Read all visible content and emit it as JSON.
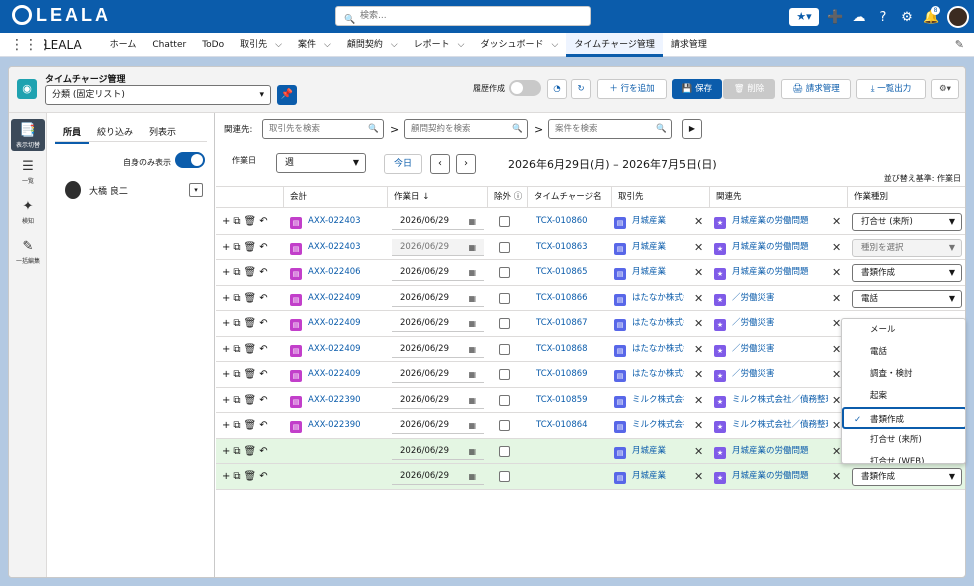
{
  "header": {
    "logo": "LEALA",
    "search_placeholder": "検索...",
    "notification_count": "8"
  },
  "nav": {
    "app_name": "LEALA",
    "items": [
      {
        "label": "ホーム",
        "caret": false
      },
      {
        "label": "Chatter",
        "caret": false
      },
      {
        "label": "ToDo",
        "caret": false
      },
      {
        "label": "取引先",
        "caret": true
      },
      {
        "label": "案件",
        "caret": true
      },
      {
        "label": "顧問契約",
        "caret": true
      },
      {
        "label": "レポート",
        "caret": true
      },
      {
        "label": "ダッシュボード",
        "caret": true
      },
      {
        "label": "タイムチャージ管理",
        "caret": false,
        "active": true
      },
      {
        "label": "請求管理",
        "caret": false
      }
    ]
  },
  "page": {
    "title": "タイムチャージ管理",
    "list_select": "分類 (固定リスト)",
    "history_label": "履歴作成",
    "add_row": "行を追加",
    "save": "保存",
    "delete": "削除",
    "billing": "請求管理",
    "export": "一覧出力"
  },
  "rail": {
    "items": [
      "表示切替",
      "一覧",
      "検知",
      "一括編集"
    ]
  },
  "left_panel": {
    "tabs": [
      "所員",
      "絞り込み",
      "列表示"
    ],
    "self_only_label": "自身のみ表示",
    "employee": "大橋 良二"
  },
  "filters": {
    "related_label": "関連先:",
    "account_placeholder": "取引先を検索",
    "contract_placeholder": "顧問契約を検索",
    "matter_placeholder": "案件を検索",
    "work_date_label": "作業日",
    "period": "週",
    "today": "今日",
    "range": "2026年6月29日(月) – 2026年7月5日(日)",
    "sort_label": "並び替え基準: 作業日"
  },
  "table": {
    "columns": [
      "会計",
      "作業日 ↓",
      "除外",
      "タイムチャージ名",
      "取引先",
      "関連先",
      "作業種別"
    ],
    "rows": [
      {
        "account": "AXX-022403",
        "date": "2026/06/29",
        "name": "TCX-010860",
        "client": "月城産業",
        "related": "月城産業の労働問題",
        "type": "打合せ (来所)",
        "green": false,
        "disabled": false
      },
      {
        "account": "AXX-022403",
        "date": "2026/06/29",
        "name": "TCX-010863",
        "client": "月城産業",
        "related": "月城産業の労働問題",
        "type": "種別を選択",
        "green": false,
        "disabled": true
      },
      {
        "account": "AXX-022406",
        "date": "2026/06/29",
        "name": "TCX-010865",
        "client": "月城産業",
        "related": "月城産業の労働問題",
        "type": "書類作成",
        "green": false,
        "disabled": false
      },
      {
        "account": "AXX-022409",
        "date": "2026/06/29",
        "name": "TCX-010866",
        "client": "はたなか株式会社",
        "related": "／労働災害",
        "type": "電話",
        "green": false,
        "disabled": false
      },
      {
        "account": "AXX-022409",
        "date": "2026/06/29",
        "name": "TCX-010867",
        "client": "はたなか株式会社",
        "related": "／労働災害",
        "type": "",
        "green": false,
        "disabled": false
      },
      {
        "account": "AXX-022409",
        "date": "2026/06/29",
        "name": "TCX-010868",
        "client": "はたなか株式会社",
        "related": "／労働災害",
        "type": "",
        "green": false,
        "disabled": false
      },
      {
        "account": "AXX-022409",
        "date": "2026/06/29",
        "name": "TCX-010869",
        "client": "はたなか株式会社",
        "related": "／労働災害",
        "type": "",
        "green": false,
        "disabled": false
      },
      {
        "account": "AXX-022390",
        "date": "2026/06/29",
        "name": "TCX-010859",
        "client": "ミルク株式会社",
        "related": "ミルク株式会社／債務整理",
        "type": "",
        "green": false,
        "disabled": false
      },
      {
        "account": "AXX-022390",
        "date": "2026/06/29",
        "name": "TCX-010864",
        "client": "ミルク株式会社",
        "related": "ミルク株式会社／債務整理",
        "type": "",
        "green": false,
        "disabled": false
      },
      {
        "account": "",
        "date": "2026/06/29",
        "name": "",
        "client": "月城産業",
        "related": "月城産業の労働問題",
        "type": "",
        "green": true,
        "disabled": false
      },
      {
        "account": "",
        "date": "2026/06/29",
        "name": "",
        "client": "月城産業",
        "related": "月城産業の労働問題",
        "type": "書類作成",
        "green": true,
        "disabled": false
      }
    ]
  },
  "dropdown": {
    "options": [
      "メール",
      "電話",
      "調査・検討",
      "起案",
      "書類作成",
      "打合せ (来所)",
      "打合せ (WEB)"
    ],
    "selected": "書類作成"
  }
}
